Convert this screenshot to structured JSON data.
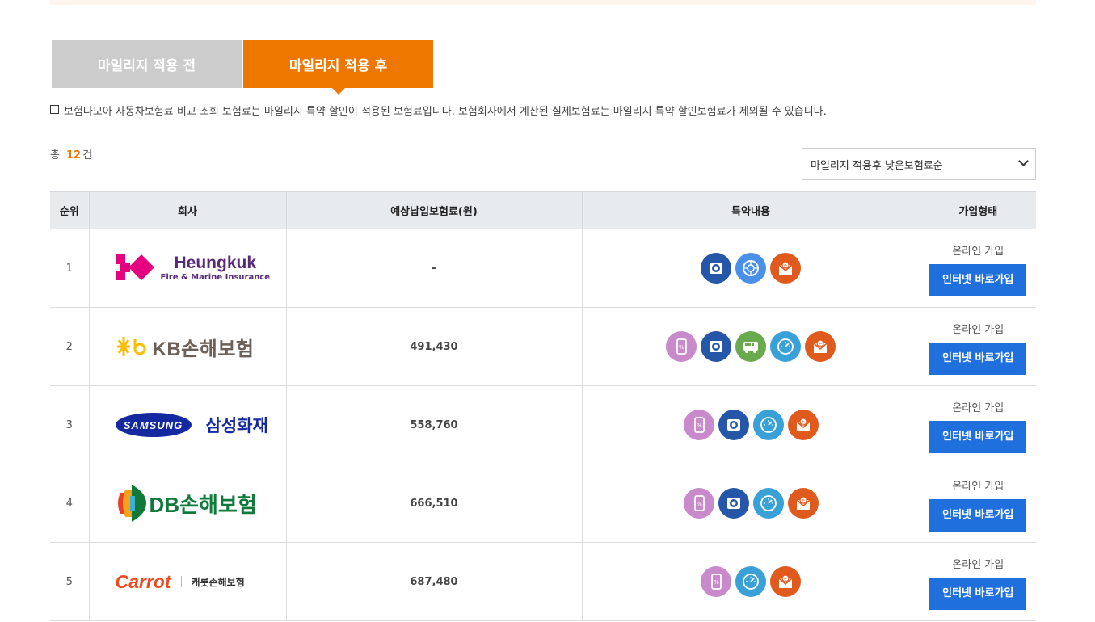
{
  "tabs": {
    "before": "마일리지 적용 전",
    "after": "마일리지 적용 후"
  },
  "notice": "보험다모아 자동차보험료 비교 조회 보험료는 마일리지 특약 할인이 적용된 보험료입니다. 보험회사에서 계산된 실제보험료는 마일리지 특약 할인보험료가 제외될 수 있습니다.",
  "summary": {
    "prefix": "총",
    "count": "12",
    "suffix": "건"
  },
  "sort": {
    "selected": "마일리지 적용후 낮은보험료순"
  },
  "table": {
    "headers": [
      "순위",
      "회사",
      "예상납입보험료(원)",
      "특약내용",
      "가입형태"
    ],
    "rows": [
      {
        "rank": "1",
        "company": "Heungkuk",
        "company_sub": "Fire & Marine Insurance",
        "price": "-",
        "icons": [
          "blackbox-icon",
          "tire-icon",
          "email-icon"
        ],
        "join_label": "온라인 가입",
        "join_button": "인터넷 바로가입"
      },
      {
        "rank": "2",
        "company": "KB손해보험",
        "company_sub": "",
        "price": "491,430",
        "icons": [
          "phone-discount-icon",
          "blackbox-icon",
          "bus-icon",
          "gauge-icon",
          "email-icon"
        ],
        "join_label": "온라인 가입",
        "join_button": "인터넷 바로가입"
      },
      {
        "rank": "3",
        "company": "삼성화재",
        "company_sub": "SAMSUNG",
        "price": "558,760",
        "icons": [
          "phone-discount-icon",
          "blackbox-icon",
          "gauge-icon",
          "email-icon"
        ],
        "join_label": "온라인 가입",
        "join_button": "인터넷 바로가입"
      },
      {
        "rank": "4",
        "company": "DB손해보험",
        "company_sub": "",
        "price": "666,510",
        "icons": [
          "phone-discount-icon",
          "blackbox-icon",
          "gauge-icon",
          "email-icon"
        ],
        "join_label": "온라인 가입",
        "join_button": "인터넷 바로가입"
      },
      {
        "rank": "5",
        "company": "Carrot",
        "company_sub": "캐롯손해보험",
        "price": "687,480",
        "icons": [
          "phone-discount-icon",
          "gauge-icon",
          "email-icon"
        ],
        "join_label": "온라인 가입",
        "join_button": "인터넷 바로가입"
      }
    ]
  },
  "colors": {
    "accent": "#ee7700",
    "button": "#1f6fdd",
    "tab_inactive": "#cccccc"
  }
}
